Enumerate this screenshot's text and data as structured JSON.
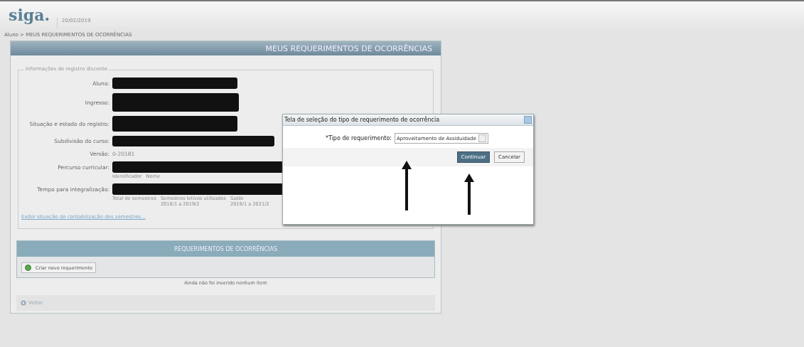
{
  "header": {
    "logo": "siga.",
    "date": "20/02/2019"
  },
  "breadcrumb": "Aluno > MEUS REQUERIMENTOS DE OCORRÊNCIAS",
  "panel": {
    "title": "MEUS REQUERIMENTOS DE OCORRÊNCIAS",
    "legend": "Informações do registro discente",
    "rows": [
      {
        "label": "Aluno:",
        "kind": "redacted-short",
        "captions": []
      },
      {
        "label": "Ingresso:",
        "kind": "redacted-tall",
        "captions": []
      },
      {
        "label": "Situação e estado do registro:",
        "kind": "redacted-medium",
        "captions": []
      },
      {
        "label": "Subdivisão do curso:",
        "kind": "redacted-long",
        "captions": []
      },
      {
        "label": "Versão:",
        "kind": "text",
        "value": "0-20181",
        "captions": []
      },
      {
        "label": "Percurso curricular:",
        "kind": "redacted-wide",
        "captions": [
          [
            "Identificador"
          ],
          [
            "Nome"
          ]
        ]
      },
      {
        "label": "Tempo para integralização:",
        "kind": "redacted-wide",
        "captions": [
          [
            "Total de semestres"
          ],
          [
            "Semestres letivos utilizados",
            "2018/1 a 2019/2"
          ],
          [
            "Saldo",
            "2019/1 a 2021/2"
          ]
        ]
      }
    ],
    "link": "Exibir situação de contabilização dos semestres...",
    "section_title": "REQUERIMENTOS DE OCORRÊNCIAS",
    "new_button": "Criar novo requerimento",
    "empty_message": "Ainda não foi inserido nenhum item",
    "back_button": "Voltar"
  },
  "dialog": {
    "title": "Tela de seleção do tipo de requerimento de ocorrência",
    "field_label": "*Tipo de requerimento:",
    "field_value": "Aproveitamento de Assiduidade",
    "buttons": [
      {
        "label": "Continuar",
        "kind": "primary"
      },
      {
        "label": "Cancelar",
        "kind": "secondary"
      }
    ]
  },
  "annotations": [
    {
      "kind": "arrow"
    },
    {
      "kind": "arrow"
    }
  ]
}
